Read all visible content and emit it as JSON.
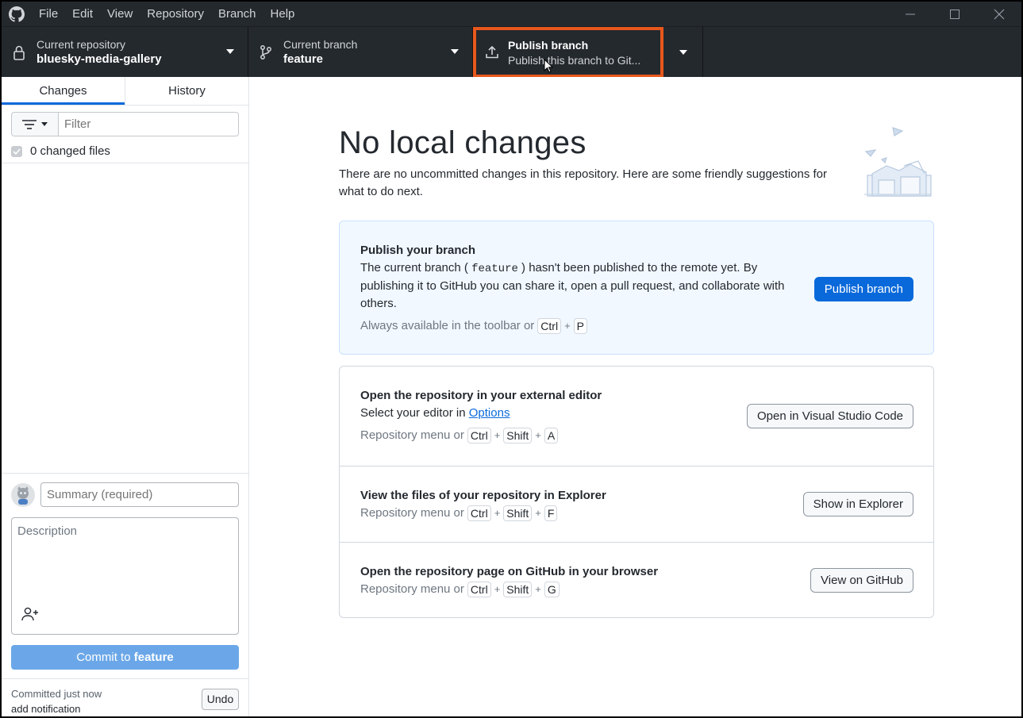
{
  "menu": [
    "File",
    "Edit",
    "View",
    "Repository",
    "Branch",
    "Help"
  ],
  "toolbar": {
    "repo_label": "Current repository",
    "repo_value": "bluesky-media-gallery",
    "branch_label": "Current branch",
    "branch_value": "feature",
    "publish_title": "Publish branch",
    "publish_sub": "Publish this branch to Git..."
  },
  "sidebar": {
    "tabs": [
      "Changes",
      "History"
    ],
    "filter_placeholder": "Filter",
    "changed_files": "0 changed files",
    "summary_placeholder": "Summary (required)",
    "description_placeholder": "Description",
    "commit_prefix": "Commit to ",
    "commit_branch": "feature",
    "last_commit_time": "Committed just now",
    "last_commit_msg": "add notification",
    "undo_label": "Undo"
  },
  "main": {
    "heading": "No local changes",
    "intro": "There are no uncommitted changes in this repository. Here are some friendly suggestions for what to do next.",
    "publish": {
      "title": "Publish your branch",
      "desc_before": "The current branch ( ",
      "branch": "feature",
      "desc_after": " ) hasn't been published to the remote yet. By publishing it to GitHub you can share it, open a pull request, and collaborate with others.",
      "hint": "Always available in the toolbar or",
      "keys": [
        "Ctrl",
        "P"
      ],
      "button": "Publish branch"
    },
    "editor": {
      "title": "Open the repository in your external editor",
      "desc_before": "Select your editor in ",
      "link": "Options",
      "hint": "Repository menu or",
      "keys": [
        "Ctrl",
        "Shift",
        "A"
      ],
      "button": "Open in Visual Studio Code"
    },
    "explorer": {
      "title": "View the files of your repository in Explorer",
      "hint": "Repository menu or",
      "keys": [
        "Ctrl",
        "Shift",
        "F"
      ],
      "button": "Show in Explorer"
    },
    "github": {
      "title": "Open the repository page on GitHub in your browser",
      "hint": "Repository menu or",
      "keys": [
        "Ctrl",
        "Shift",
        "G"
      ],
      "button": "View on GitHub"
    }
  },
  "colors": {
    "titlebar": "#24292e",
    "highlight": "#e8581c",
    "primary": "#0969da",
    "commit_disabled": "#6ba7e8"
  }
}
